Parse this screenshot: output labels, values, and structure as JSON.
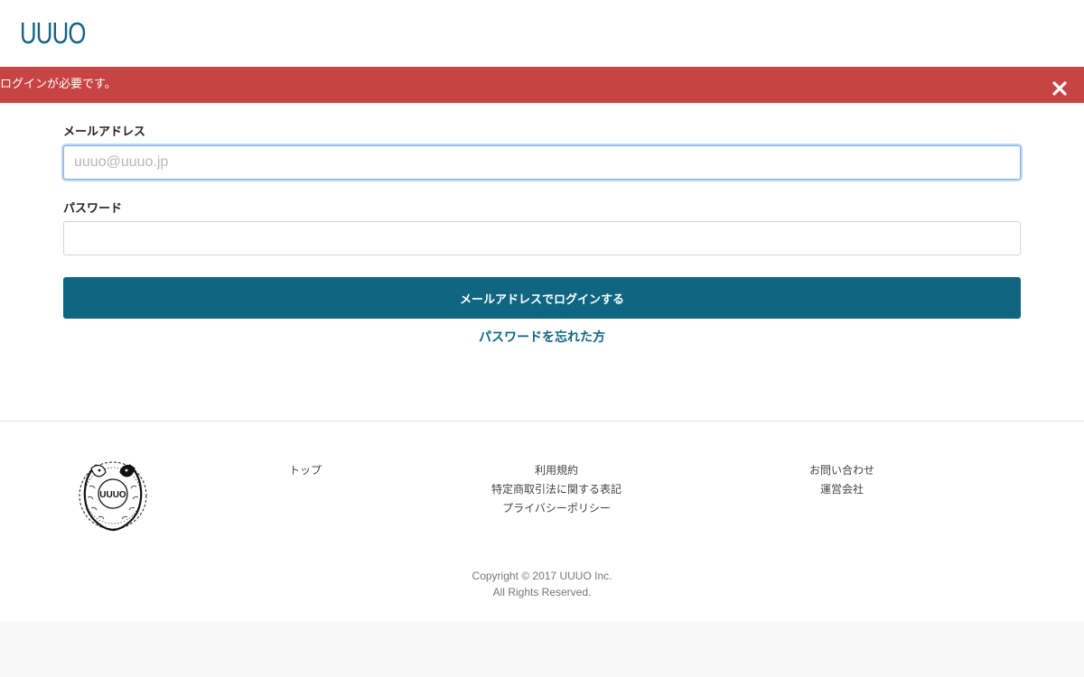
{
  "header": {
    "logo_text": "UUUO"
  },
  "alert": {
    "message": "ログインが必要です。",
    "close_icon": "close-icon",
    "color": "#c74444"
  },
  "login_form": {
    "email_label": "メールアドレス",
    "email_placeholder": "uuuo@uuuo.jp",
    "email_value": "",
    "password_label": "パスワード",
    "password_value": "",
    "submit_label": "メールアドレスでログインする",
    "forgot_password_link": "パスワードを忘れた方",
    "accent_color": "#106580"
  },
  "footer": {
    "emblem_text": "UUUO",
    "columns": [
      {
        "links": [
          "トップ"
        ]
      },
      {
        "links": [
          "利用規約",
          "特定商取引法に関する表記",
          "プライバシーポリシー"
        ]
      },
      {
        "links": [
          "お問い合わせ",
          "運営会社"
        ]
      }
    ],
    "copyright_line1": "Copyright © 2017 UUUO Inc.",
    "copyright_line2": "All Rights Reserved."
  }
}
